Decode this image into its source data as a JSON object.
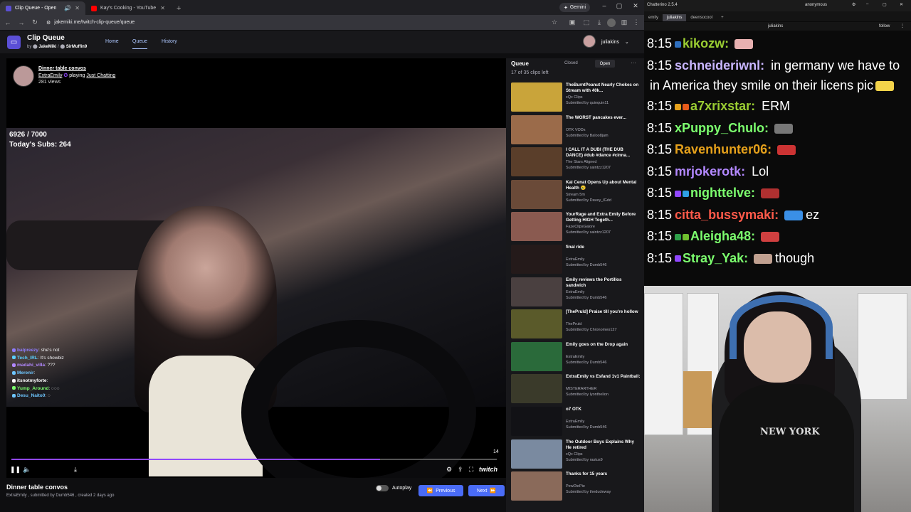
{
  "browser": {
    "tabs": [
      {
        "title": "Clip Queue - Open",
        "active": true,
        "icon_color": "#5b4fd6"
      },
      {
        "title": "Kay's Cooking - YouTube",
        "active": false,
        "icon_color": "#ff0000"
      }
    ],
    "new_tab": "+",
    "gemini_label": "Gemini",
    "url": "jakemiki.me/twitch-clip-queue/queue",
    "window_controls": [
      "–",
      "▢",
      "✕"
    ]
  },
  "site": {
    "app_title": "Clip Queue",
    "by": "by",
    "author1": "JakeMiki",
    "separator": "/",
    "author2": "SirMuffin9",
    "nav": [
      "Home",
      "Queue",
      "History"
    ],
    "user": "juliakins"
  },
  "player": {
    "clip_title": "Dinner table convos",
    "channel": "ExtraEmily",
    "playing": "playing",
    "game": "Just Chatting",
    "views": "281 views",
    "sub_count": "6926 / 7000",
    "todays_subs": "Today's Subs: 264",
    "clip_length": "14",
    "progress": 0.76,
    "twitch_label": "twitch",
    "overlay_chat": [
      {
        "user": "balpreezy",
        "color": "#8f7cff",
        "msg": "she's not"
      },
      {
        "user": "Tech_IRL",
        "color": "#5ad1ff",
        "msg": "It's showbiz"
      },
      {
        "user": "madahi_villa",
        "color": "#b388ff",
        "msg": "???"
      },
      {
        "user": "Merenir",
        "color": "#6ec6ff",
        "msg": ""
      },
      {
        "user": "itsnotmyforte",
        "color": "#ffffff",
        "msg": ""
      },
      {
        "user": "Yump_Around",
        "color": "#7cff6e",
        "msg": "◌◌◌"
      },
      {
        "user": "Desu_Naito0",
        "color": "#6ec6ff",
        "msg": "◌"
      }
    ]
  },
  "below": {
    "title": "Dinner table convos",
    "subtitle": "ExtraEmily , submitted by Dumb546 , created 2 days ago",
    "autoplay": "Autoplay",
    "previous": "Previous",
    "next": "Next"
  },
  "queue": {
    "title": "Queue",
    "closed": "Closed",
    "open": "Open",
    "more": "···",
    "count": "17 of 35 clips left",
    "items": [
      {
        "title": "TheBurntPeanut Nearly Chokes on Stream with 40k...",
        "channel": "xQc Clips",
        "submitter": "Submitted by quinquin11",
        "thumb": "#c9a43a"
      },
      {
        "title": "The WORST pancakes ever...",
        "channel": "OTK VODs",
        "submitter": "Submitted by Baloo8jam",
        "thumb": "#9b6b4a"
      },
      {
        "title": "I CALL IT A DUBI (THE DUB DANCE) #dub #dance #cinna...",
        "channel": "The Stars Aligned",
        "submitter": "Submitted by saintzz1207",
        "thumb": "#5a3e2a"
      },
      {
        "title": "Kai Cenat Opens Up about Mental Health 😢",
        "channel": "Stream 5m",
        "submitter": "Submitted by Davey_lGdd",
        "thumb": "#6a4a38"
      },
      {
        "title": "YourRage and Extra Emily Before Getting HIGH Togeth...",
        "channel": "FazeClipsGalore",
        "submitter": "Submitted by saintzz1207",
        "thumb": "#8a5a50"
      },
      {
        "title": "final ride",
        "channel": "ExtraEmily",
        "submitter": "Submitted by Dumb546",
        "thumb": "#241a1a"
      },
      {
        "title": "Emily reviews the Portillos sandwich",
        "channel": "ExtraEmily",
        "submitter": "Submitted by Dumb546",
        "thumb": "#4a4040"
      },
      {
        "title": "[ThePruld] Praise till you're hollow",
        "channel": "ThePruld",
        "submitter": "Submitted by Chronomeo127",
        "thumb": "#5a5a2a"
      },
      {
        "title": "Emily goes on the Drop again",
        "channel": "ExtraEmily",
        "submitter": "Submitted by Dumb546",
        "thumb": "#2a6a3a"
      },
      {
        "title": "ExtraEmily vs Esfand 1v1 Paintball:",
        "channel": "MISTERARTHER",
        "submitter": "Submitted by lyonthelion",
        "thumb": "#3a3a2a"
      },
      {
        "title": "o7 OTK",
        "channel": "ExtraEmily",
        "submitter": "Submitted by Dumb546",
        "thumb": "#121216"
      },
      {
        "title": "The Outdoor Boys Explains Why He retired",
        "channel": "xQc Clips",
        "submitter": "Submitted by rastus9",
        "thumb": "#7a8aa0"
      },
      {
        "title": "Thanks for 15 years",
        "channel": "PewDiePie",
        "submitter": "Submitted by thedudeway",
        "thumb": "#8a6a5a"
      }
    ]
  },
  "chatterino": {
    "title": "Chatterino 2.5.4",
    "account": "anonymous",
    "tabs": [
      "emily",
      "juliakins",
      "deensocool"
    ],
    "active_tab": "juliakins",
    "channel": "juliakins",
    "follow": "follow",
    "lines": [
      {
        "time": "8:15",
        "user": "kikozw:",
        "color": "#9acd32",
        "text": "",
        "badges": [
          "#2e6fbf"
        ],
        "emote": "#e7b0b0"
      },
      {
        "time": "8:15",
        "user": "schneideriwnl:",
        "color": "#c9b6ff",
        "text": "in germany we have to",
        "badges": [],
        "emote": ""
      },
      {
        "time": "",
        "user": "",
        "color": "#ffffff",
        "text": "in America they smile on their licens pic",
        "badges": [],
        "emote": "#f3d34a"
      },
      {
        "time": "8:15",
        "user": "a7xrixstar:",
        "color": "#9acd32",
        "text": "ERM",
        "badges": [
          "#e6a11b",
          "#e65b1b"
        ],
        "emote": ""
      },
      {
        "time": "8:15",
        "user": "xPuppy_Chulo:",
        "color": "#7cff6e",
        "text": "",
        "badges": [],
        "emote": "#777777"
      },
      {
        "time": "8:15",
        "user": "Ravenhunter06:",
        "color": "#e6a11b",
        "text": "",
        "badges": [],
        "emote": "#cc3333"
      },
      {
        "time": "8:15",
        "user": "mrjokerotk:",
        "color": "#b388ff",
        "text": "Lol",
        "badges": [],
        "emote": ""
      },
      {
        "time": "8:15",
        "user": "nighttelve:",
        "color": "#7cff6e",
        "text": "",
        "badges": [
          "#9147ff",
          "#2ea0e6"
        ],
        "emote": "#b03030"
      },
      {
        "time": "8:15",
        "user": "citta_bussymaki:",
        "color": "#ff5a4a",
        "text": "ez",
        "badges": [],
        "emote": "#3a8fe6"
      },
      {
        "time": "8:15",
        "user": "Aleigha48:",
        "color": "#7cff6e",
        "text": "",
        "badges": [
          "#2ea04a",
          "#6fbf2e"
        ],
        "emote": "#d04040"
      },
      {
        "time": "8:15",
        "user": "Stray_Yak:",
        "color": "#7cff6e",
        "text": "though",
        "badges": [
          "#9147ff"
        ],
        "emote": "#c0a090"
      }
    ]
  },
  "webcam": {
    "shirt_text": "NEW YORK"
  }
}
